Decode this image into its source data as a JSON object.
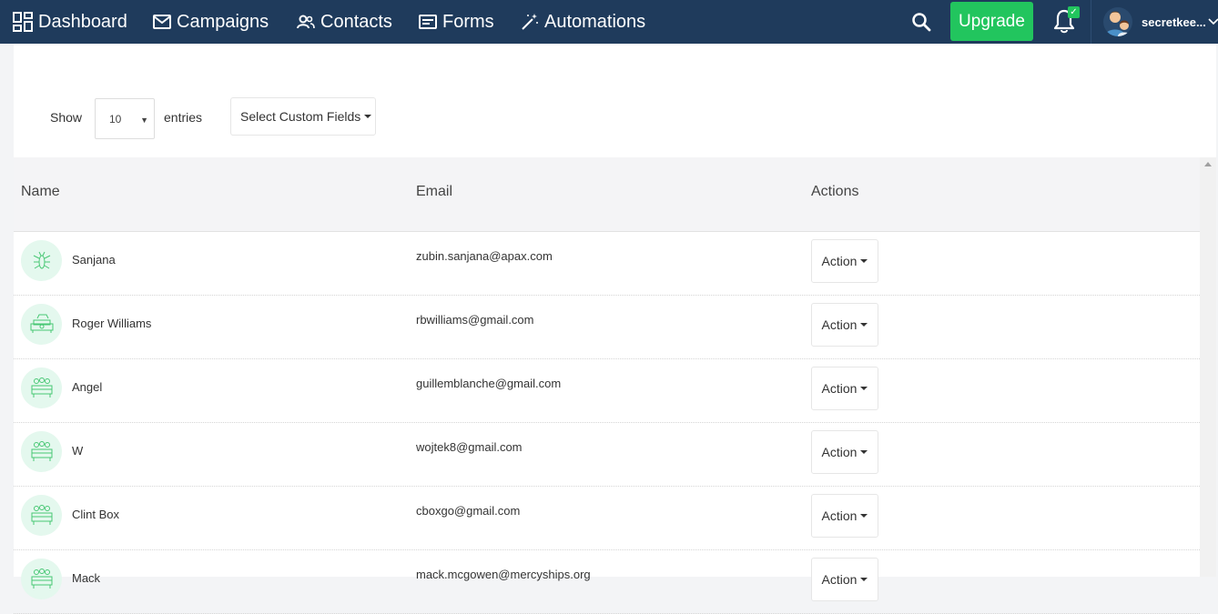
{
  "nav": {
    "items": [
      {
        "label": "Dashboard",
        "icon": "dashboard-icon"
      },
      {
        "label": "Campaigns",
        "icon": "mail-icon"
      },
      {
        "label": "Contacts",
        "icon": "contacts-icon"
      },
      {
        "label": "Forms",
        "icon": "forms-icon"
      },
      {
        "label": "Automations",
        "icon": "magic-wand-icon"
      }
    ],
    "upgrade_label": "Upgrade",
    "username": "secretkee..."
  },
  "controls": {
    "show_label": "Show",
    "entries_value": "10",
    "entries_label": "entries",
    "custom_fields_label": "Select Custom Fields"
  },
  "table": {
    "headers": {
      "name": "Name",
      "email": "Email",
      "actions": "Actions"
    },
    "action_label": "Action",
    "rows": [
      {
        "name": "Sanjana",
        "email": "zubin.sanjana@apax.com",
        "avatar": "insect-icon"
      },
      {
        "name": "Roger Williams",
        "email": "rbwilliams@gmail.com",
        "avatar": "sofa-icon"
      },
      {
        "name": "Angel",
        "email": "guillemblanche@gmail.com",
        "avatar": "chair-icon"
      },
      {
        "name": "W",
        "email": "wojtek8@gmail.com",
        "avatar": "chair-icon"
      },
      {
        "name": "Clint Box",
        "email": "cboxgo@gmail.com",
        "avatar": "chair-icon"
      },
      {
        "name": "Mack",
        "email": "mack.mcgowen@mercyships.org",
        "avatar": "chair-icon"
      }
    ]
  },
  "colors": {
    "nav_bg": "#1f3b5c",
    "accent": "#22c55e",
    "avatar_bg": "#e4f8ee"
  }
}
